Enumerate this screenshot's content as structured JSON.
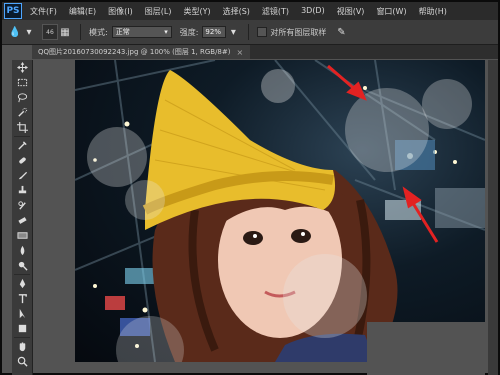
{
  "app": {
    "logo": "PS",
    "menu": [
      "文件(F)",
      "编辑(E)",
      "图像(I)",
      "图层(L)",
      "类型(Y)",
      "选择(S)",
      "滤镜(T)",
      "3D(D)",
      "视图(V)",
      "窗口(W)",
      "帮助(H)"
    ]
  },
  "options": {
    "brush_size": "46",
    "mode_label": "模式:",
    "mode_value": "正常",
    "strength_label": "强度:",
    "strength_value": "92%",
    "sample_all_layers": "对所有图层取样"
  },
  "document": {
    "tab_title": "QQ图片20160730092243.jpg @ 100% (图层 1, RGB/8#)",
    "close": "×"
  },
  "tools": [
    "move-tool",
    "marquee-tool",
    "lasso-tool",
    "quick-select-tool",
    "crop-tool",
    "eyedropper-tool",
    "healing-brush-tool",
    "brush-tool",
    "clone-stamp-tool",
    "history-brush-tool",
    "eraser-tool",
    "gradient-tool",
    "blur-tool",
    "dodge-tool",
    "pen-tool",
    "type-tool",
    "path-select-tool",
    "shape-tool",
    "hand-tool",
    "zoom-tool"
  ],
  "colors": {
    "hat": "#e8bd2c",
    "arrow": "#e32222"
  }
}
